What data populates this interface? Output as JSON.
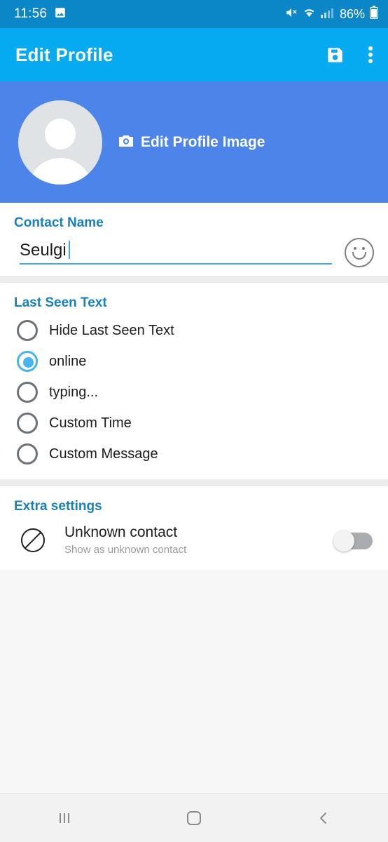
{
  "statusbar": {
    "time": "11:56",
    "battery_text": "86%",
    "icons": [
      "image-icon",
      "mute-icon",
      "wifi-icon",
      "signal-icon",
      "battery-icon"
    ]
  },
  "appbar": {
    "title": "Edit Profile",
    "save_icon": "save-floppy-icon",
    "overflow_icon": "overflow-menu-icon",
    "background_color": "#06aaf0"
  },
  "profile_header": {
    "background_color": "#4c84ea",
    "avatar_icon": "default-avatar-icon",
    "edit_image_label": "Edit Profile Image",
    "camera_icon": "camera-icon"
  },
  "contact_name": {
    "section_title": "Contact Name",
    "value": "Seulgi",
    "placeholder": "Contact Name",
    "emoji_icon": "emoji-smiley-icon",
    "underline_color": "#4aa8e0"
  },
  "last_seen": {
    "section_title": "Last Seen Text",
    "selected": "online",
    "accent_color": "#45b4ef",
    "options": [
      {
        "label": "Hide Last Seen Text",
        "checked": false
      },
      {
        "label": "online",
        "checked": true
      },
      {
        "label": "typing...",
        "checked": false
      },
      {
        "label": "Custom Time",
        "checked": false
      },
      {
        "label": "Custom Message",
        "checked": false
      }
    ]
  },
  "extra_settings": {
    "section_title": "Extra settings",
    "items": [
      {
        "icon": "block-circle-icon",
        "title": "Unknown contact",
        "subtitle": "Show as unknown contact",
        "toggle_on": false
      }
    ]
  },
  "navbar": {
    "recents_icon": "recents-icon",
    "home_icon": "home-icon",
    "back_icon": "back-icon"
  },
  "theme": {
    "section_title_color": "#1a7fbd",
    "status_bar_color": "#0b87c8"
  }
}
